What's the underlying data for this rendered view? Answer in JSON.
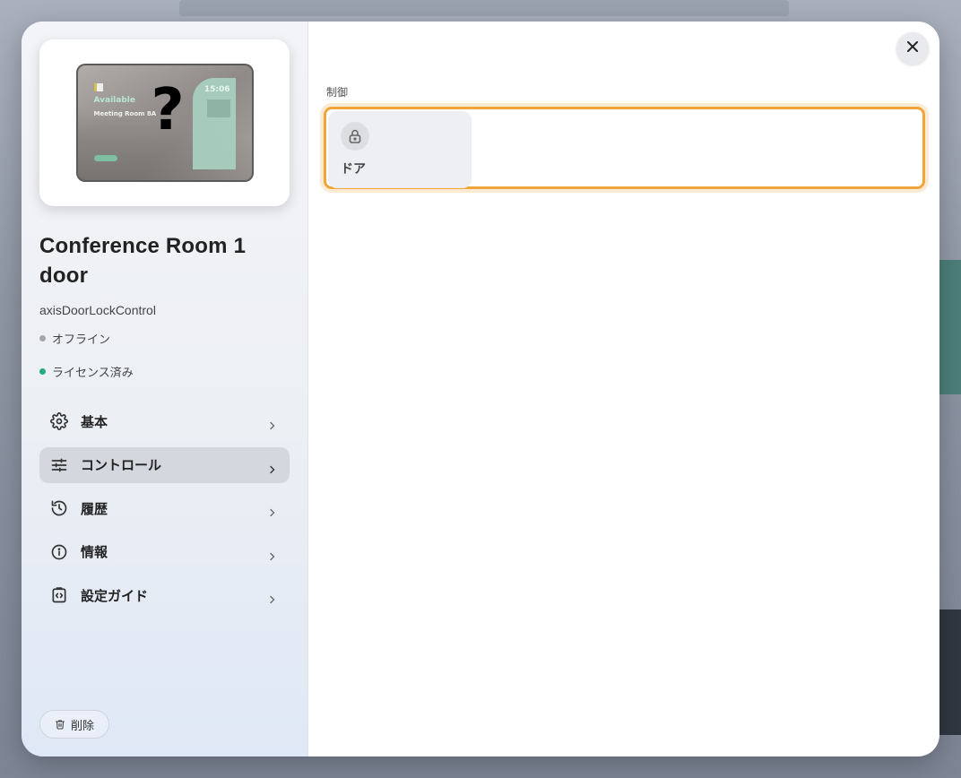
{
  "device": {
    "title": "Conference Room 1 door",
    "model": "axisDoorLockControl",
    "preview": {
      "availability": "Available",
      "time": "15:06",
      "room_name": "Meeting Room 8A",
      "unknown_symbol": "?"
    },
    "statuses": [
      {
        "label": "オフライン",
        "color": "#a3a7ad"
      },
      {
        "label": "ライセンス済み",
        "color": "#1fae7c"
      }
    ]
  },
  "nav": {
    "items": [
      {
        "label": "基本",
        "icon": "gear-icon",
        "active": false
      },
      {
        "label": "コントロール",
        "icon": "sliders-icon",
        "active": true
      },
      {
        "label": "履歴",
        "icon": "history-icon",
        "active": false
      },
      {
        "label": "情報",
        "icon": "info-icon",
        "active": false
      },
      {
        "label": "設定ガイド",
        "icon": "code-clipboard-icon",
        "active": false
      }
    ]
  },
  "actions": {
    "delete_label": "削除"
  },
  "main": {
    "section_label": "制御",
    "controls": [
      {
        "label": "ドア",
        "icon": "lock-icon"
      }
    ]
  },
  "colors": {
    "accent_highlight": "#f0a53a",
    "active_nav": "#d4d7de",
    "licensed": "#1fae7c"
  }
}
